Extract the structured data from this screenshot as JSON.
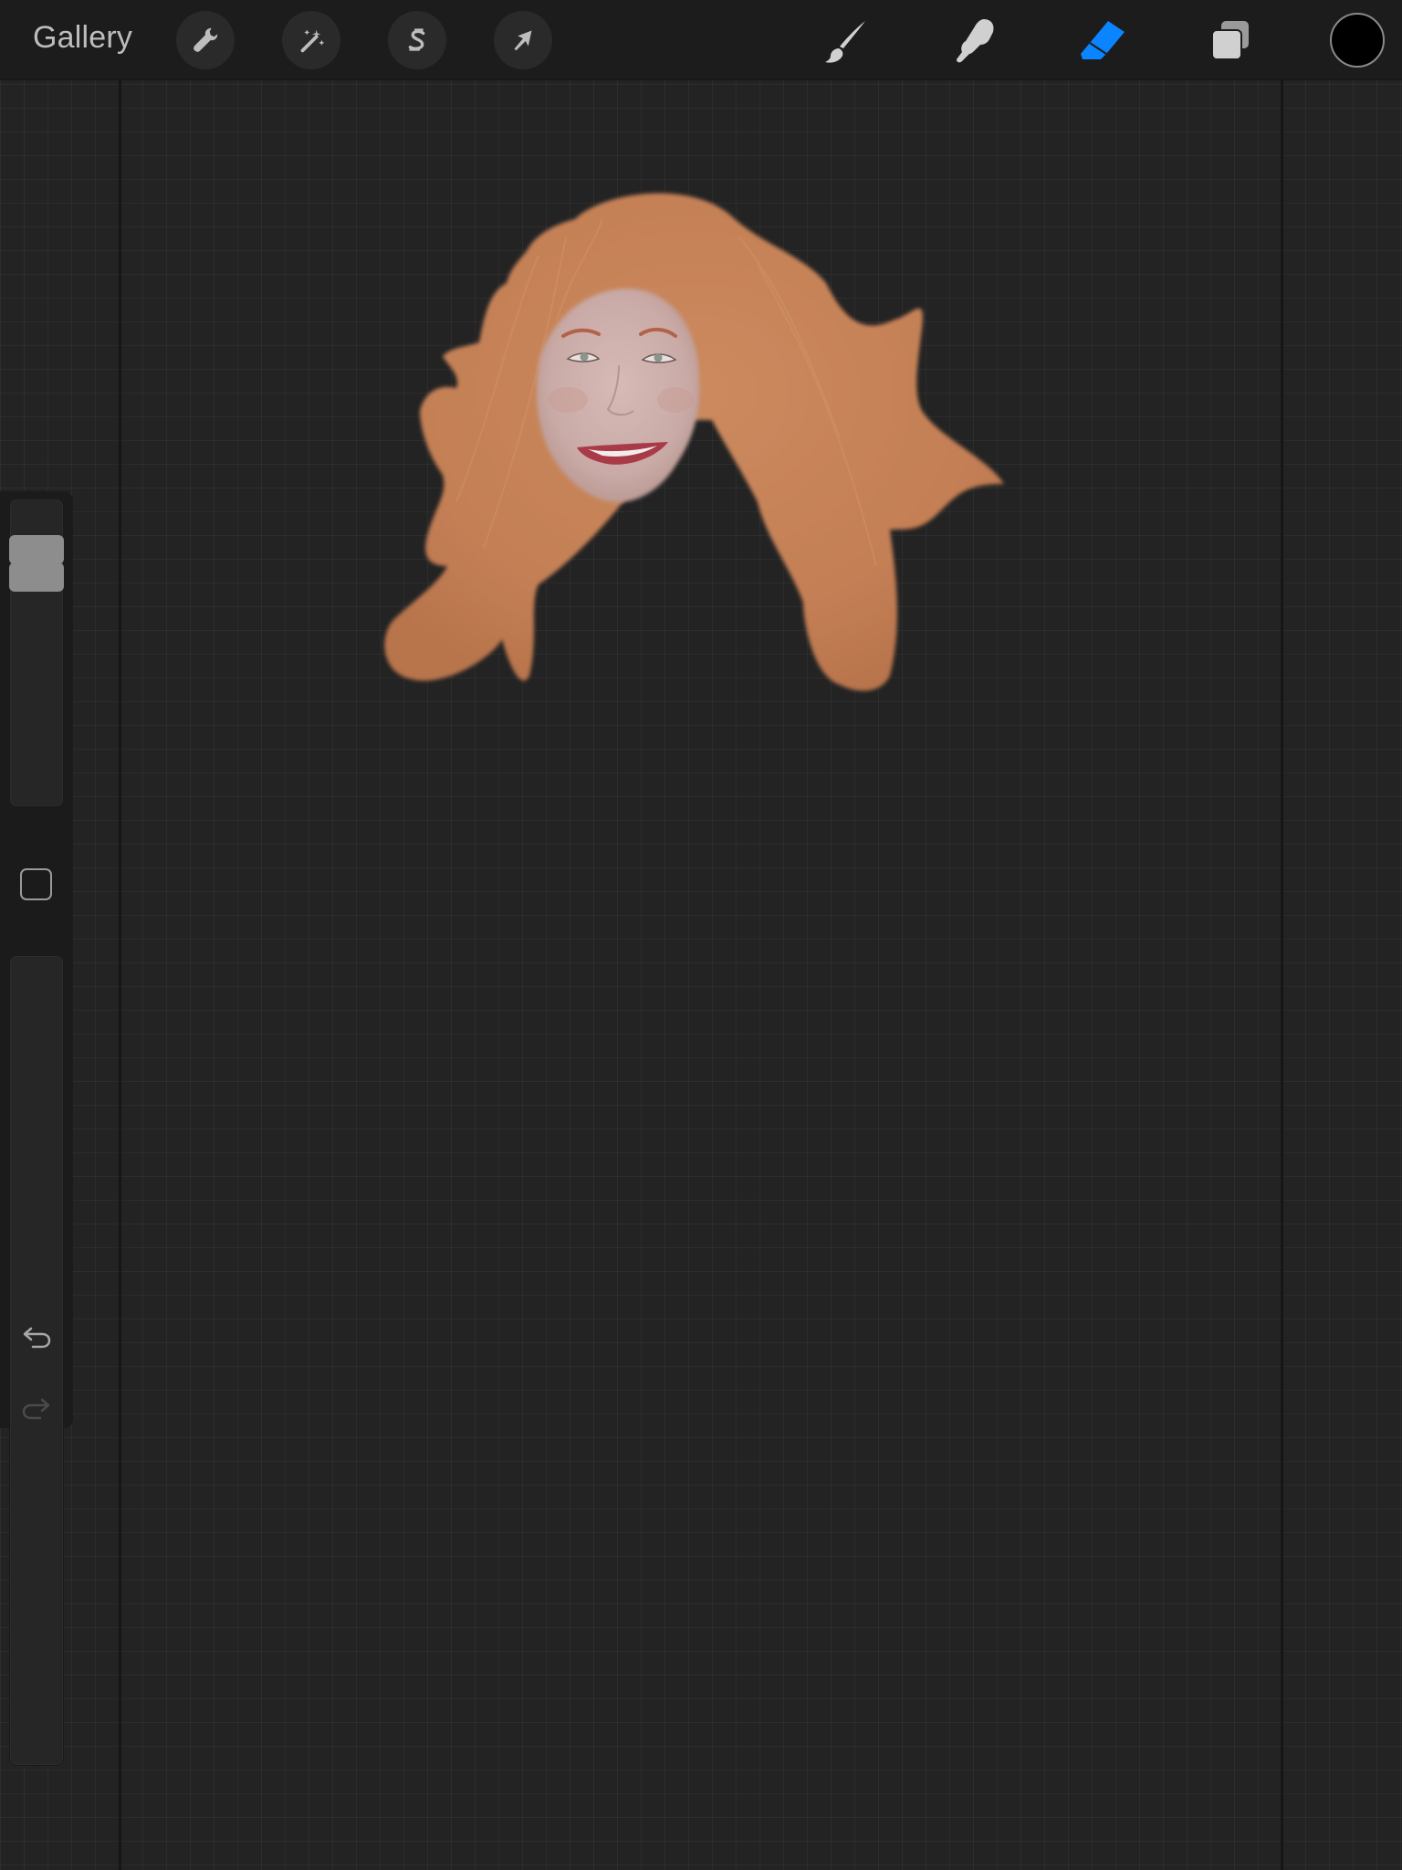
{
  "toolbar": {
    "gallery_label": "Gallery",
    "left_tools": [
      {
        "name": "actions",
        "icon": "wrench-icon"
      },
      {
        "name": "adjustments",
        "icon": "magic-wand-icon"
      },
      {
        "name": "selection",
        "icon": "selection-s-icon"
      },
      {
        "name": "transform",
        "icon": "arrow-cursor-icon"
      }
    ],
    "right_tools": [
      {
        "name": "brush",
        "icon": "paintbrush-icon",
        "active": false
      },
      {
        "name": "smudge",
        "icon": "smudge-finger-icon",
        "active": false
      },
      {
        "name": "eraser",
        "icon": "eraser-icon",
        "active": true
      },
      {
        "name": "layers",
        "icon": "layers-icon",
        "active": false
      }
    ],
    "current_color": "#000000",
    "active_tool_color": "#0a84ff"
  },
  "sidebar": {
    "brush_size_level": 0.78,
    "opacity_level": 0.0,
    "modify_button_icon": "square-icon",
    "undo_icon": "undo-arrow-icon",
    "redo_icon": "redo-arrow-icon",
    "redo_enabled": false
  },
  "artwork": {
    "subject": "portrait-icon",
    "hair_color": "#c7845a",
    "skin_color": "#cdb0ac",
    "lip_color": "#a93a48"
  }
}
